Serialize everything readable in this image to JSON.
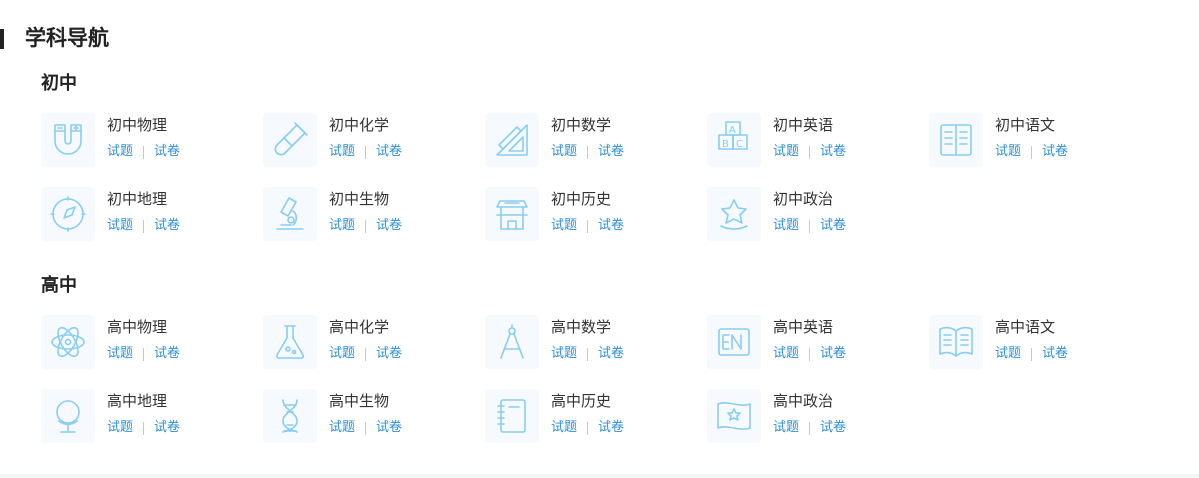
{
  "page": {
    "title": "学科导航"
  },
  "sections": [
    {
      "title": "初中",
      "subjects": [
        {
          "name": "初中物理",
          "icon": "magnet-icon",
          "links": [
            "试题",
            "试卷"
          ]
        },
        {
          "name": "初中化学",
          "icon": "test-tube-icon",
          "links": [
            "试题",
            "试卷"
          ]
        },
        {
          "name": "初中数学",
          "icon": "ruler-triangle-icon",
          "links": [
            "试题",
            "试卷"
          ]
        },
        {
          "name": "初中英语",
          "icon": "abc-blocks-icon",
          "links": [
            "试题",
            "试卷"
          ]
        },
        {
          "name": "初中语文",
          "icon": "open-book-icon",
          "links": [
            "试题",
            "试卷"
          ]
        },
        {
          "name": "初中地理",
          "icon": "compass-icon",
          "links": [
            "试题",
            "试卷"
          ]
        },
        {
          "name": "初中生物",
          "icon": "microscope-icon",
          "links": [
            "试题",
            "试卷"
          ]
        },
        {
          "name": "初中历史",
          "icon": "ancient-building-icon",
          "links": [
            "试题",
            "试卷"
          ]
        },
        {
          "name": "初中政治",
          "icon": "star-emblem-icon",
          "links": [
            "试题",
            "试卷"
          ]
        }
      ]
    },
    {
      "title": "高中",
      "subjects": [
        {
          "name": "高中物理",
          "icon": "atom-icon",
          "links": [
            "试题",
            "试卷"
          ]
        },
        {
          "name": "高中化学",
          "icon": "flask-icon",
          "links": [
            "试题",
            "试卷"
          ]
        },
        {
          "name": "高中数学",
          "icon": "drafting-compass-icon",
          "links": [
            "试题",
            "试卷"
          ]
        },
        {
          "name": "高中英语",
          "icon": "en-badge-icon",
          "links": [
            "试题",
            "试卷"
          ]
        },
        {
          "name": "高中语文",
          "icon": "book-icon",
          "links": [
            "试题",
            "试卷"
          ]
        },
        {
          "name": "高中地理",
          "icon": "globe-icon",
          "links": [
            "试题",
            "试卷"
          ]
        },
        {
          "name": "高中生物",
          "icon": "dna-icon",
          "links": [
            "试题",
            "试卷"
          ]
        },
        {
          "name": "高中历史",
          "icon": "notebook-icon",
          "links": [
            "试题",
            "试卷"
          ]
        },
        {
          "name": "高中政治",
          "icon": "flag-icon",
          "links": [
            "试题",
            "试卷"
          ]
        }
      ]
    }
  ],
  "colors": {
    "accent": "#2f8fd9",
    "icon": "#88cdf2",
    "title": "#222222",
    "text": "#333333"
  }
}
